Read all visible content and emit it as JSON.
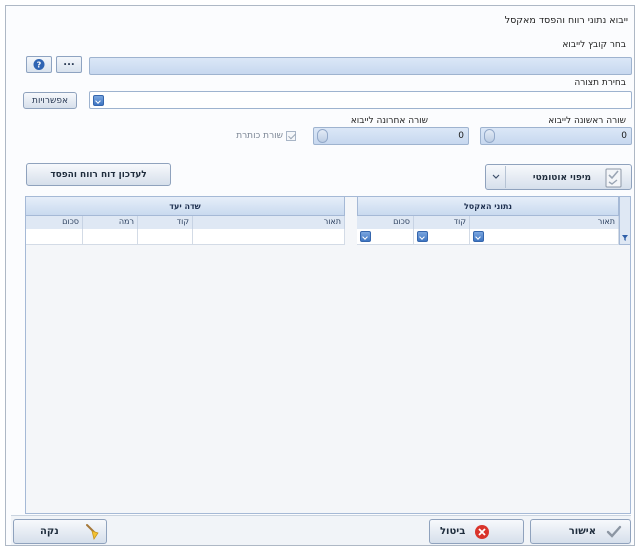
{
  "window": {
    "title": "ייבוא נתוני רווח והפסד מאקסל"
  },
  "file": {
    "label": "בחר קובץ לייבוא",
    "value": "",
    "help_icon": "help-icon",
    "browse_label": "..."
  },
  "view": {
    "label": "בחירת תצורה",
    "value": "",
    "options_label": "אפשרויות"
  },
  "rows": {
    "first_label": "שורה ראשונה לייבוא",
    "first_value": "0",
    "last_label": "שורה אחרונה לייבוא",
    "last_value": "0",
    "header_row_label": "שורת כותרת",
    "header_row_checked": true
  },
  "actions": {
    "auto_map_label": "מיפוי אוטומטי",
    "update_report_label": "לעדכון דוח רווח והפסד"
  },
  "excel_grid": {
    "title": "נתוני האקסל",
    "columns": [
      "תאור",
      "קוד",
      "סכום"
    ]
  },
  "target_grid": {
    "title": "שדה יעד",
    "columns": [
      "תאור",
      "קוד",
      "רמה",
      "סכום"
    ]
  },
  "footer": {
    "ok_label": "אישור",
    "cancel_label": "ביטול",
    "clear_label": "נקה"
  },
  "colors": {
    "accent": "#3f76c2",
    "field_fill": "#d3e1f3",
    "cancel_red": "#d9342b",
    "ok_gray": "#8c96a3"
  }
}
